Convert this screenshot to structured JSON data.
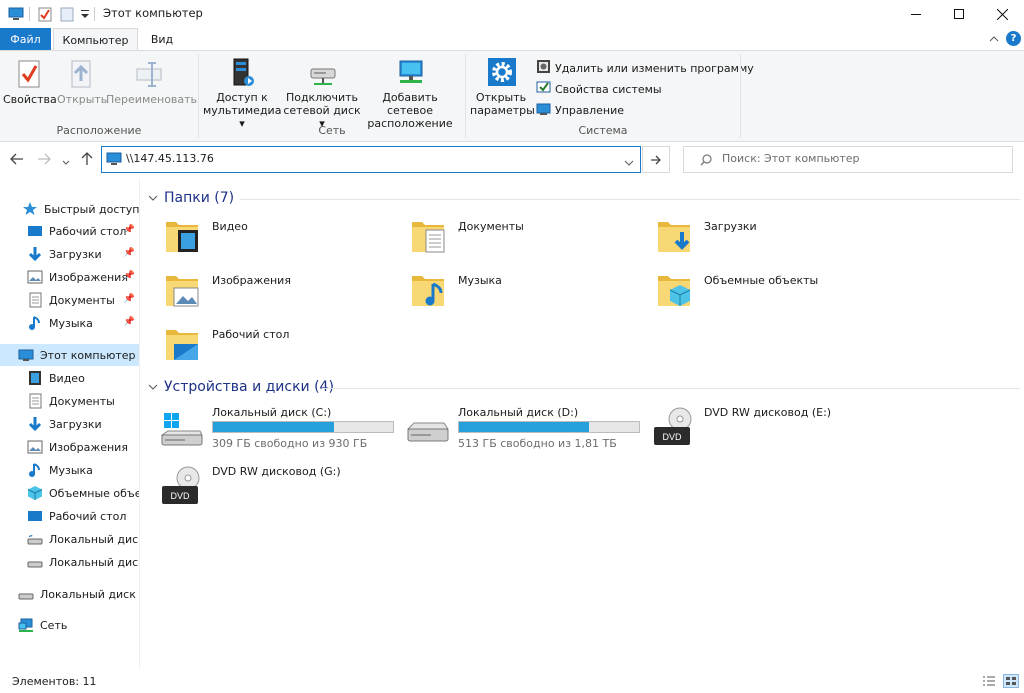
{
  "window": {
    "title": "Этот компьютер"
  },
  "tabs": {
    "file": "Файл",
    "computer": "Компьютер",
    "view": "Вид"
  },
  "ribbon": {
    "properties": "Свойства",
    "open": "Открыть",
    "rename": "Переименовать",
    "group_location": "Расположение",
    "media_access_l1": "Доступ к",
    "media_access_l2": "мультимедиа",
    "map_drive_l1": "Подключить",
    "map_drive_l2": "сетевой диск",
    "add_location_l1": "Добавить сетевое",
    "add_location_l2": "расположение",
    "group_network": "Сеть",
    "open_settings_l1": "Открыть",
    "open_settings_l2": "параметры",
    "uninstall": "Удалить или изменить программу",
    "system_props": "Свойства системы",
    "manage": "Управление",
    "group_system": "Система"
  },
  "address": {
    "value": "\\\\147.45.113.76"
  },
  "search": {
    "placeholder": "Поиск: Этот компьютер"
  },
  "sidebar": {
    "quick_access": "Быстрый доступ",
    "qa_items": [
      "Рабочий стол",
      "Загрузки",
      "Изображения",
      "Документы",
      "Музыка"
    ],
    "this_pc": "Этот компьютер",
    "pc_items": [
      "Видео",
      "Документы",
      "Загрузки",
      "Изображения",
      "Музыка",
      "Объемные объекты",
      "Рабочий стол",
      "Локальный диск (C:)",
      "Локальный диск (D:)"
    ],
    "local_disk": "Локальный диск (E:)",
    "network": "Сеть"
  },
  "folders_section": {
    "title": "Папки (7)"
  },
  "folders": [
    "Видео",
    "Документы",
    "Загрузки",
    "Изображения",
    "Музыка",
    "Объемные объекты",
    "Рабочий стол"
  ],
  "devices_section": {
    "title": "Устройства и диски (4)"
  },
  "drives": [
    {
      "name": "Локальный диск (C:)",
      "free": "309 ГБ свободно из 930 ГБ",
      "used_fraction": 0.67
    },
    {
      "name": "Локальный диск (D:)",
      "free": "513 ГБ свободно из 1,81 ТБ",
      "used_fraction": 0.72
    },
    {
      "name": "DVD RW дисковод (E:)"
    },
    {
      "name": "DVD RW дисковод (G:)"
    }
  ],
  "dvd_badge": "DVD",
  "status": {
    "items": "Элементов: 11"
  },
  "colors": {
    "accent": "#1979ca",
    "bar_fill": "#26a0da",
    "folder": "#f8d775",
    "section_title": "#1e3287"
  }
}
